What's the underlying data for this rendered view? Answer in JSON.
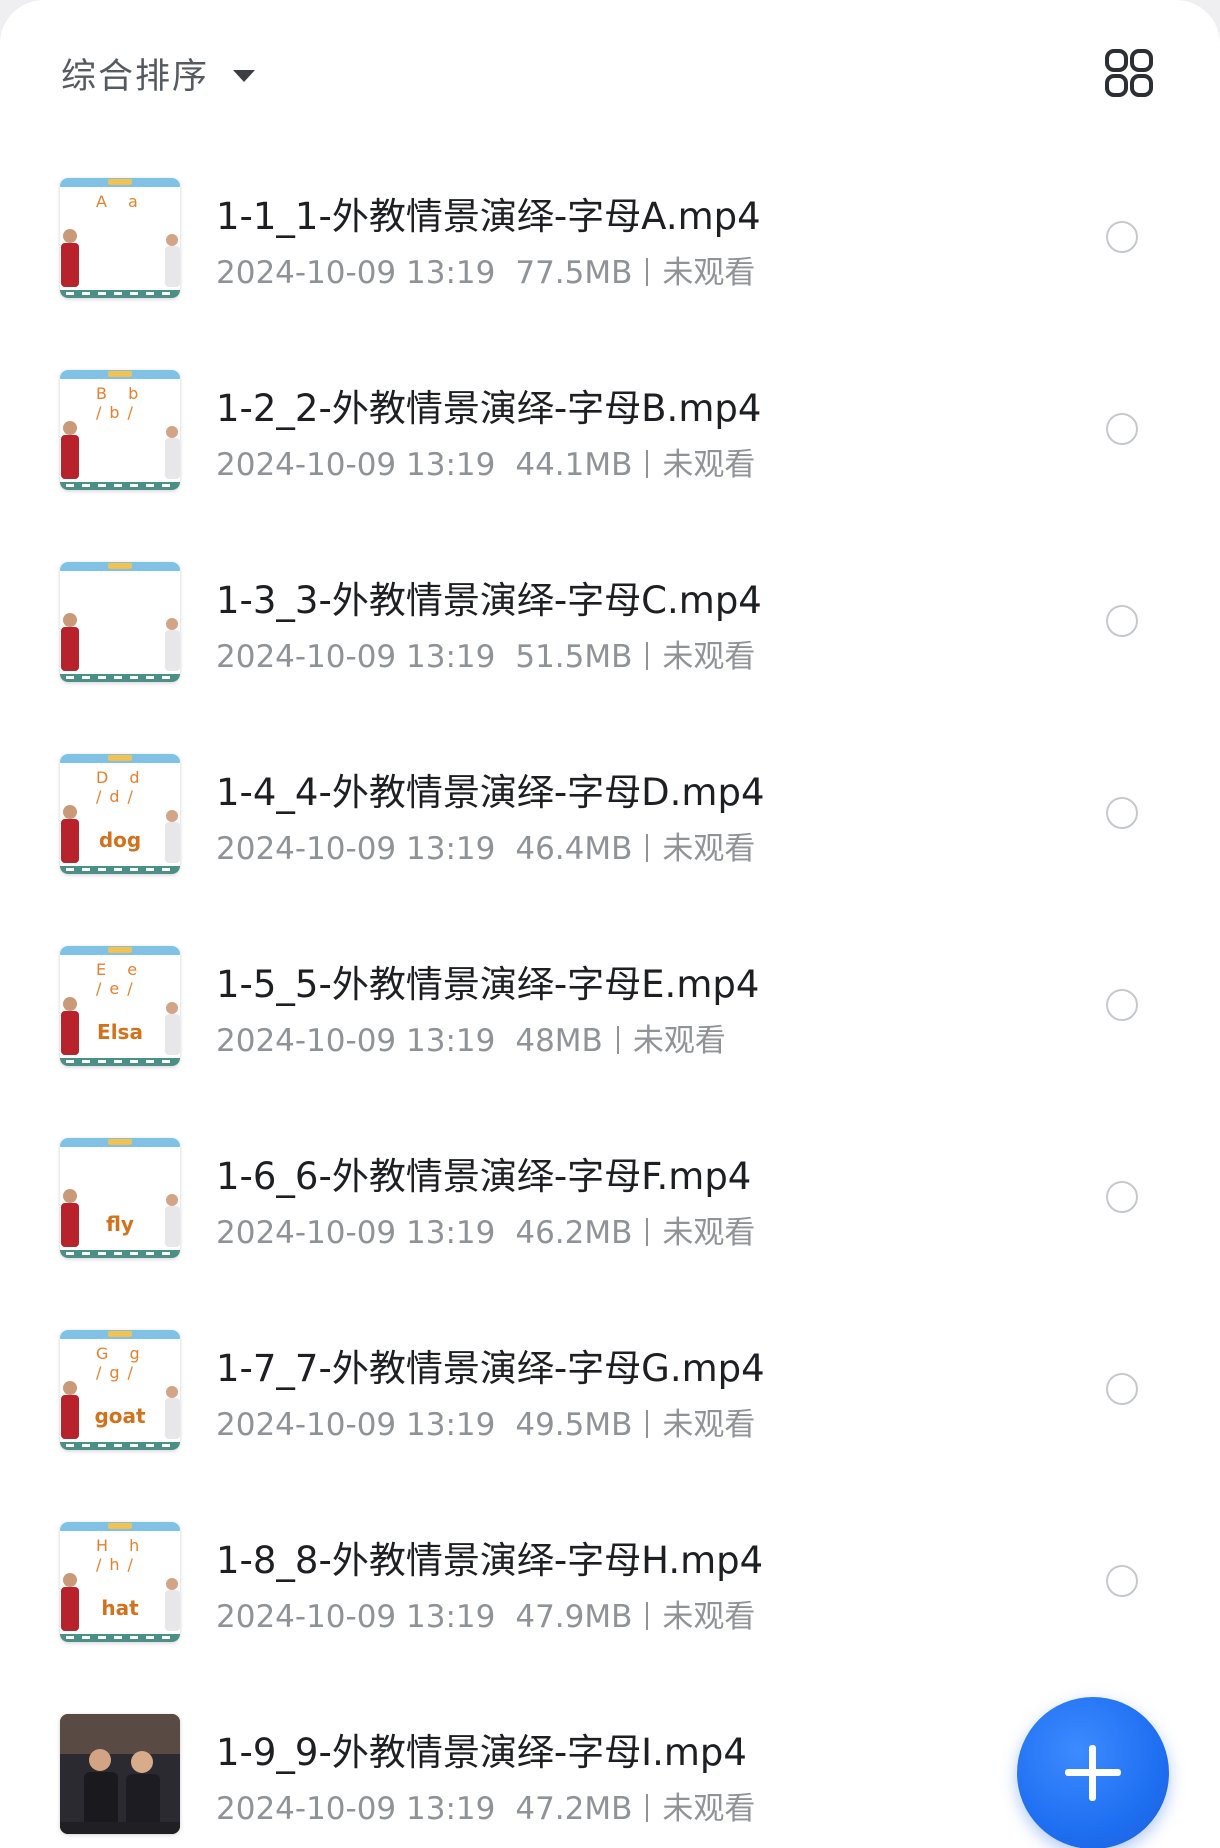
{
  "header": {
    "sort_label": "综合排序",
    "sort_icon": "caret-down-icon",
    "view_toggle_icon": "grid-view-icon"
  },
  "files": [
    {
      "title": "1-1_1-外教情景演绎-字母A.mp4",
      "date": "2024-10-09 13:19",
      "size": "77.5MB",
      "status": "未观看",
      "thumb_word": "",
      "thumb_letters": "A a"
    },
    {
      "title": "1-2_2-外教情景演绎-字母B.mp4",
      "date": "2024-10-09 13:19",
      "size": "44.1MB",
      "status": "未观看",
      "thumb_word": "",
      "thumb_letters": "B b /b/"
    },
    {
      "title": "1-3_3-外教情景演绎-字母C.mp4",
      "date": "2024-10-09 13:19",
      "size": "51.5MB",
      "status": "未观看",
      "thumb_word": "",
      "thumb_letters": ""
    },
    {
      "title": "1-4_4-外教情景演绎-字母D.mp4",
      "date": "2024-10-09 13:19",
      "size": "46.4MB",
      "status": "未观看",
      "thumb_word": "dog",
      "thumb_letters": "D d /d/"
    },
    {
      "title": "1-5_5-外教情景演绎-字母E.mp4",
      "date": "2024-10-09 13:19",
      "size": "48MB",
      "status": "未观看",
      "thumb_word": "Elsa",
      "thumb_letters": "E e /e/"
    },
    {
      "title": "1-6_6-外教情景演绎-字母F.mp4",
      "date": "2024-10-09 13:19",
      "size": "46.2MB",
      "status": "未观看",
      "thumb_word": "fly",
      "thumb_letters": ""
    },
    {
      "title": "1-7_7-外教情景演绎-字母G.mp4",
      "date": "2024-10-09 13:19",
      "size": "49.5MB",
      "status": "未观看",
      "thumb_word": "goat",
      "thumb_letters": "G g /g/"
    },
    {
      "title": "1-8_8-外教情景演绎-字母H.mp4",
      "date": "2024-10-09 13:19",
      "size": "47.9MB",
      "status": "未观看",
      "thumb_word": "hat",
      "thumb_letters": "H h /h/"
    },
    {
      "title": "1-9_9-外教情景演绎-字母I.mp4",
      "date": "2024-10-09 13:19",
      "size": "47.2MB",
      "status": "未观看",
      "thumb_word": "",
      "thumb_letters": ""
    }
  ],
  "fab": {
    "icon": "plus-icon"
  },
  "colors": {
    "accent": "#1f6ff2",
    "title_text": "#1d1f22",
    "meta_text": "#8f9398"
  }
}
